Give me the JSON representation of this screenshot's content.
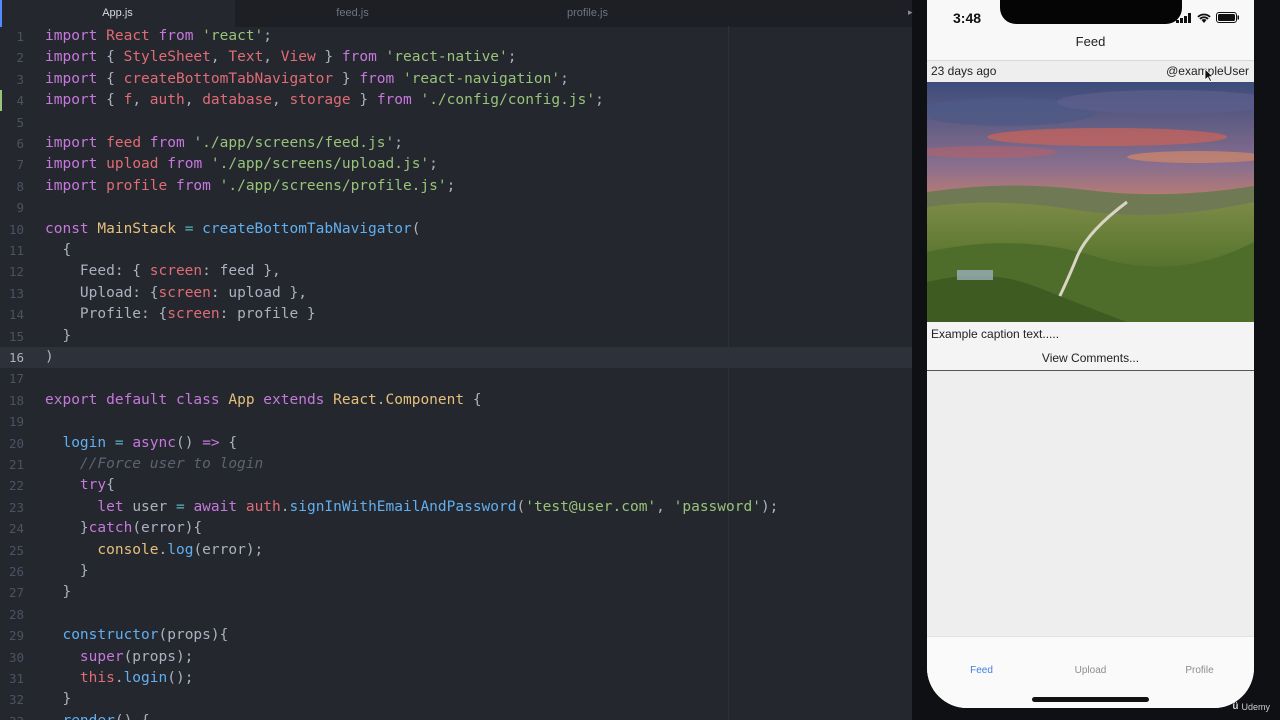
{
  "editor": {
    "tabs": [
      {
        "label": "App.js",
        "active": true
      },
      {
        "label": "feed.js",
        "active": false
      },
      {
        "label": "profile.js",
        "active": false
      }
    ],
    "current_line": 16,
    "modified_line": 4
  },
  "phone": {
    "status_time": "3:48",
    "nav_title": "Feed",
    "post": {
      "time": "23 days ago",
      "user": "@exampleUser",
      "caption": "Example caption text.....",
      "comments_link": "View Comments..."
    },
    "tabs": [
      {
        "label": "Feed",
        "active": true
      },
      {
        "label": "Upload",
        "active": false
      },
      {
        "label": "Profile",
        "active": false
      }
    ]
  },
  "watermark": {
    "text": "Udemy",
    "mark": "ü"
  },
  "colors": {
    "editor_bg": "#24272e",
    "keyword": "#c678dd",
    "string": "#98c379",
    "variable": "#e06c75",
    "function": "#61afef",
    "accent": "#3f7fe0"
  }
}
